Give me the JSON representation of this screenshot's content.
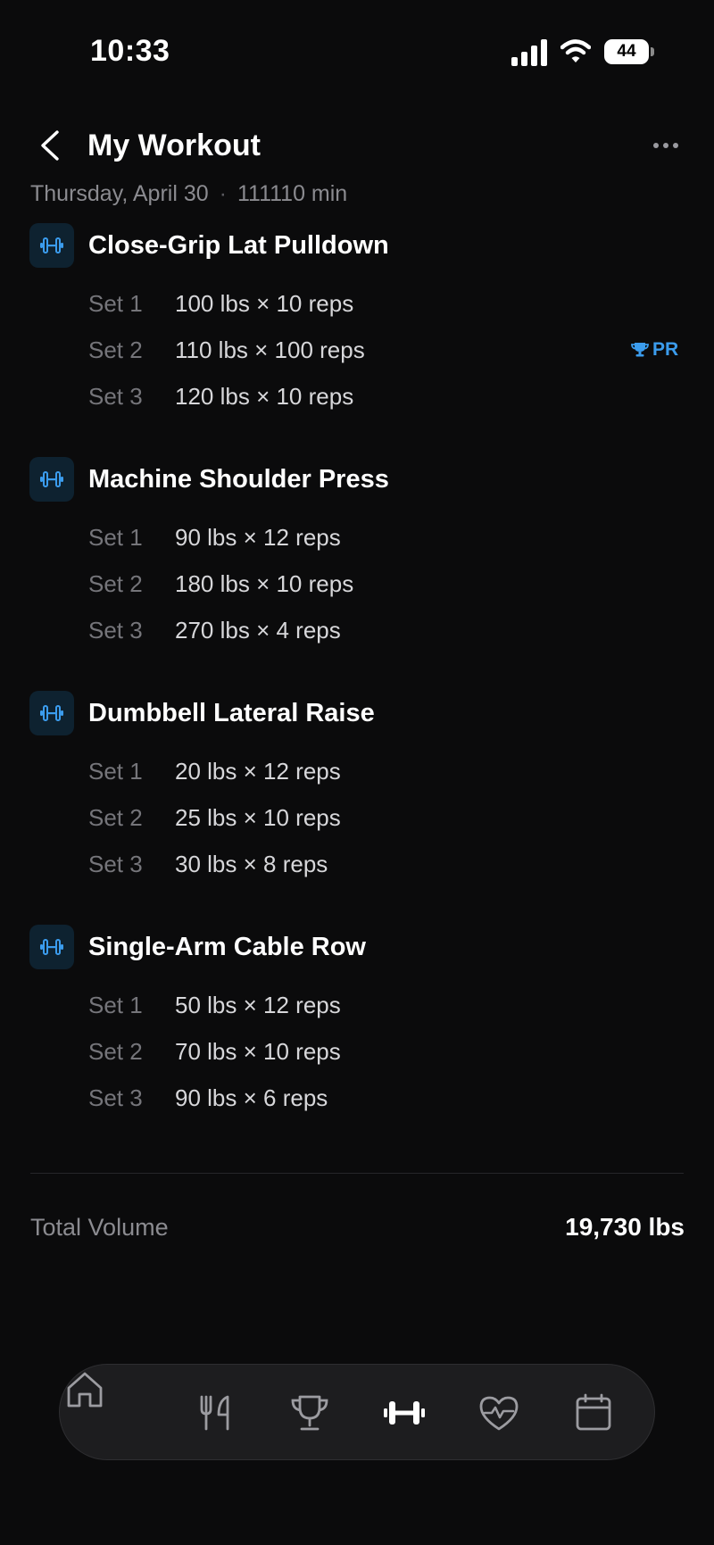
{
  "status_bar": {
    "time": "10:33",
    "battery": "44",
    "icons": [
      "cellular-signal-icon",
      "wifi-icon",
      "battery-icon"
    ]
  },
  "header": {
    "title": "My Workout",
    "back_icon": "chevron-left-icon",
    "more_icon": "more-horizontal-icon"
  },
  "workout": {
    "date": "Thursday, April 30",
    "separator": "·",
    "duration": "111110 min"
  },
  "exercises": [
    {
      "name": "Close-Grip Lat Pulldown",
      "icon": "dumbbell-icon",
      "sets": [
        {
          "label": "Set 1",
          "value": "100 lbs × 10 reps"
        },
        {
          "label": "Set 2",
          "value": "110 lbs × 100 reps",
          "badge": "PR"
        },
        {
          "label": "Set 3",
          "value": "120 lbs × 10 reps"
        }
      ]
    },
    {
      "name": "Machine Shoulder Press",
      "icon": "dumbbell-icon",
      "sets": [
        {
          "label": "Set 1",
          "value": "90 lbs × 12 reps"
        },
        {
          "label": "Set 2",
          "value": "180 lbs × 10 reps"
        },
        {
          "label": "Set 3",
          "value": "270 lbs × 4 reps"
        }
      ]
    },
    {
      "name": "Dumbbell Lateral Raise",
      "icon": "dumbbell-icon",
      "sets": [
        {
          "label": "Set 1",
          "value": "20 lbs × 12 reps"
        },
        {
          "label": "Set 2",
          "value": "25 lbs × 10 reps"
        },
        {
          "label": "Set 3",
          "value": "30 lbs × 8 reps"
        }
      ]
    },
    {
      "name": "Single-Arm Cable Row",
      "icon": "dumbbell-icon",
      "sets": [
        {
          "label": "Set 1",
          "value": "50 lbs × 12 reps"
        },
        {
          "label": "Set 2",
          "value": "70 lbs × 10 reps"
        },
        {
          "label": "Set 3",
          "value": "90 lbs × 6 reps"
        }
      ]
    }
  ],
  "summary": {
    "total_label": "Total Volume",
    "total_value": "19,730 lbs"
  },
  "tab_bar": {
    "active": "workout",
    "tabs": [
      {
        "id": "home",
        "icon": "home-icon"
      },
      {
        "id": "nutrition",
        "icon": "fork-knife-icon"
      },
      {
        "id": "achievements",
        "icon": "trophy-icon"
      },
      {
        "id": "workout",
        "icon": "dumbbell-icon"
      },
      {
        "id": "health",
        "icon": "heart-pulse-icon"
      },
      {
        "id": "calendar",
        "icon": "calendar-icon"
      }
    ]
  },
  "colors": {
    "background": "#0b0b0c",
    "accent": "#3b9ced",
    "text_primary": "#ffffff",
    "text_secondary": "#8b8b90",
    "tab_bar_bg": "#1d1d1f"
  }
}
